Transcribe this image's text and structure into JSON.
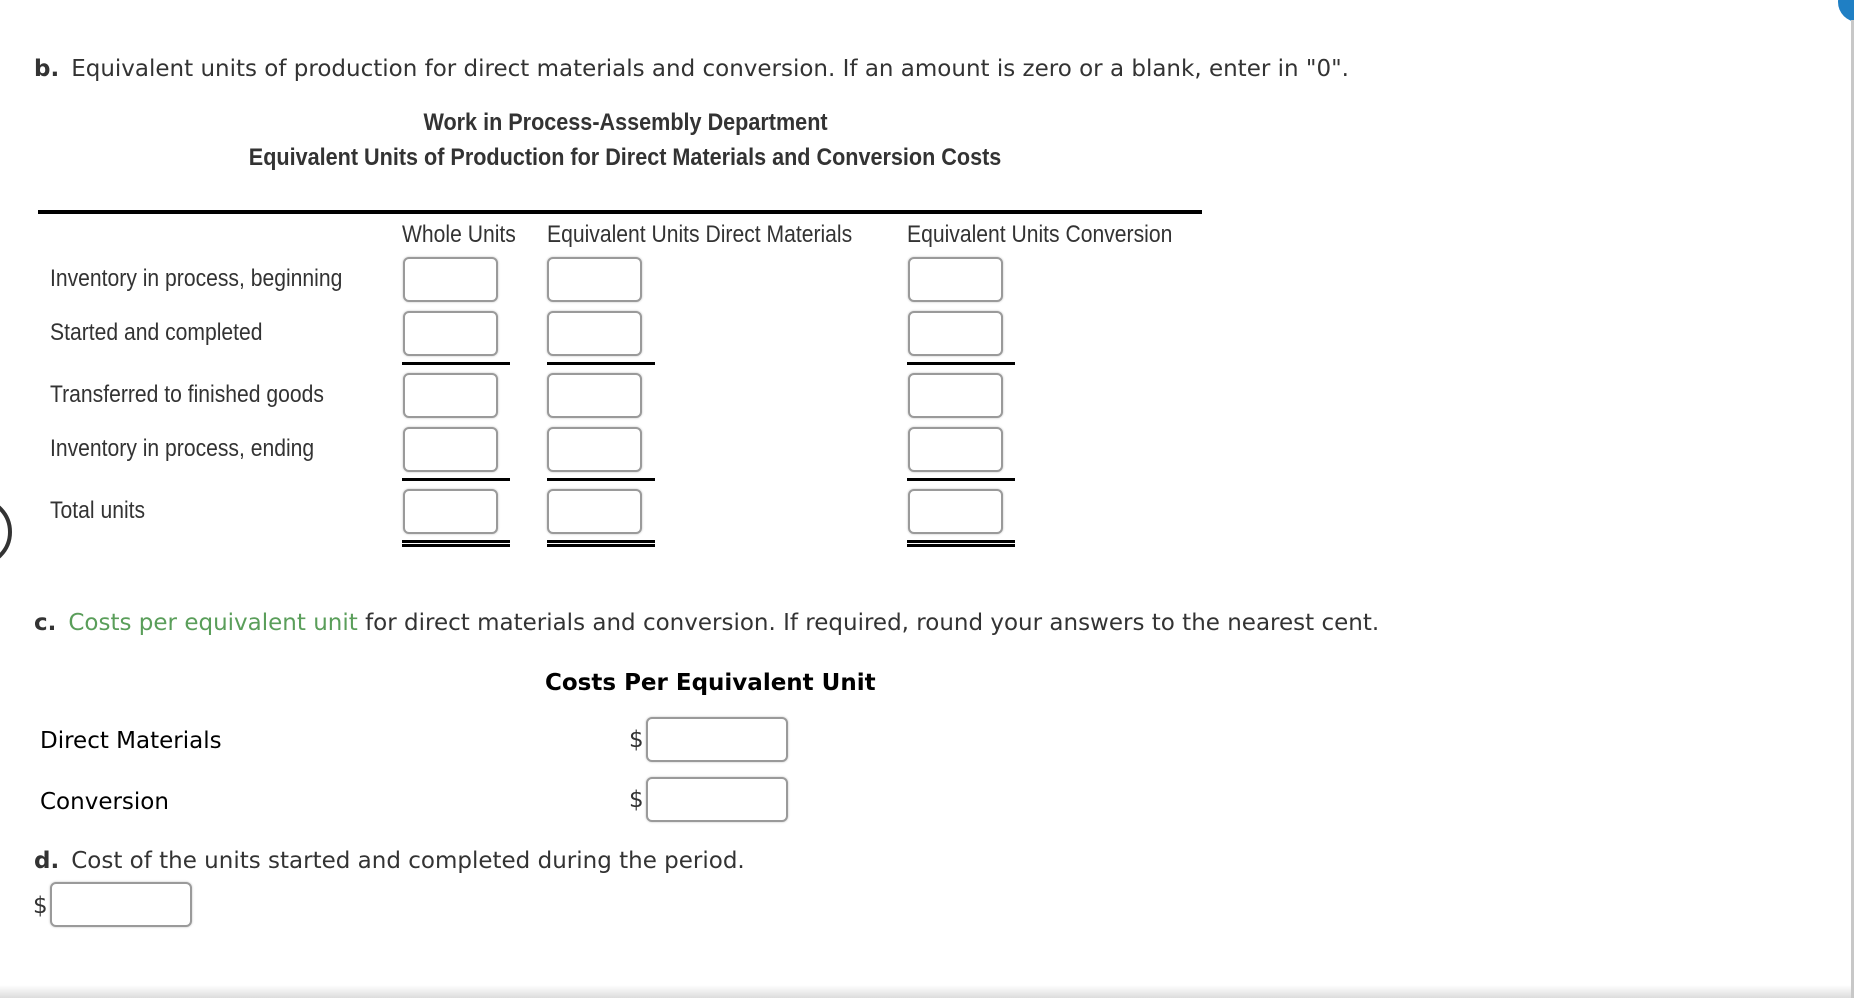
{
  "part_b": {
    "letter": "b.",
    "instruction": "Equivalent units of production for direct materials and conversion. If an amount is zero or a blank, enter in \"0\".",
    "title_line1": "Work in Process-Assembly Department",
    "title_line2": "Equivalent Units of Production for Direct Materials and Conversion Costs",
    "columns": [
      "Whole Units",
      "Equivalent Units Direct Materials",
      "Equivalent Units Conversion"
    ],
    "rows": [
      {
        "label": "Inventory in process, beginning",
        "whole_units": "",
        "eu_direct_materials": "",
        "eu_conversion": ""
      },
      {
        "label": "Started and completed",
        "whole_units": "",
        "eu_direct_materials": "",
        "eu_conversion": ""
      },
      {
        "label": "Transferred to finished goods",
        "whole_units": "",
        "eu_direct_materials": "",
        "eu_conversion": ""
      },
      {
        "label": "Inventory in process, ending",
        "whole_units": "",
        "eu_direct_materials": "",
        "eu_conversion": ""
      },
      {
        "label": "Total units",
        "whole_units": "",
        "eu_direct_materials": "",
        "eu_conversion": ""
      }
    ]
  },
  "part_c": {
    "letter": "c.",
    "link_text": "Costs per equivalent unit",
    "instruction_rest": " for direct materials and conversion. If required, round your answers to the nearest cent.",
    "heading": "Costs Per Equivalent Unit",
    "currency_symbol": "$",
    "rows": [
      {
        "label": "Direct Materials",
        "value": ""
      },
      {
        "label": "Conversion",
        "value": ""
      }
    ]
  },
  "part_d": {
    "letter": "d.",
    "instruction": "Cost of the units started and completed during the period.",
    "currency_symbol": "$",
    "value": ""
  },
  "colors": {
    "link_green": "#5a9e5a",
    "badge_blue": "#1f7fc4"
  }
}
